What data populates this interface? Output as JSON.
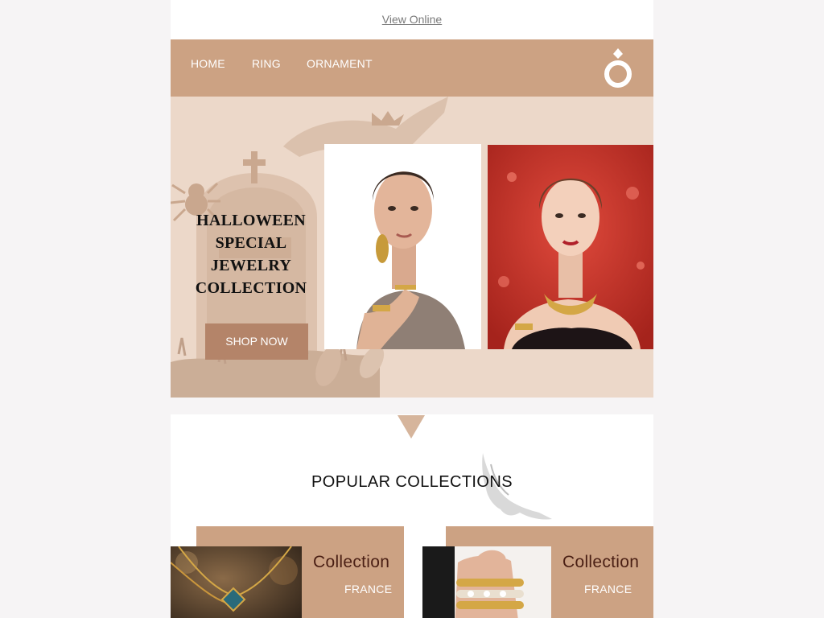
{
  "header": {
    "view_online": "View Online"
  },
  "nav": {
    "items": [
      {
        "label": "HOME"
      },
      {
        "label": "RING"
      },
      {
        "label": "ORNAMENT"
      }
    ],
    "logo_icon": "ring-icon"
  },
  "hero": {
    "title_lines": [
      "HALLOWEEN",
      "SPECIAL",
      "JEWELRY",
      "COLLECTION"
    ],
    "button_label": "SHOP NOW",
    "photos": [
      {
        "icon": "model-with-gold-jewelry-photo"
      },
      {
        "icon": "model-with-gold-necklace-red-background-photo"
      }
    ]
  },
  "popular": {
    "title": "POPULAR COLLECTIONS",
    "cards": [
      {
        "title": "Collection",
        "subtitle": "FRANCE",
        "icon": "pendant-necklace-photo"
      },
      {
        "title": "Collection",
        "subtitle": "FRANCE",
        "icon": "pearl-bracelets-photo"
      }
    ]
  },
  "colors": {
    "page_background": "#f6f4f5",
    "accent": "#cca283",
    "button": "#b48469",
    "hero_background": "#ecd8c9",
    "card_title": "#4a1f14"
  }
}
